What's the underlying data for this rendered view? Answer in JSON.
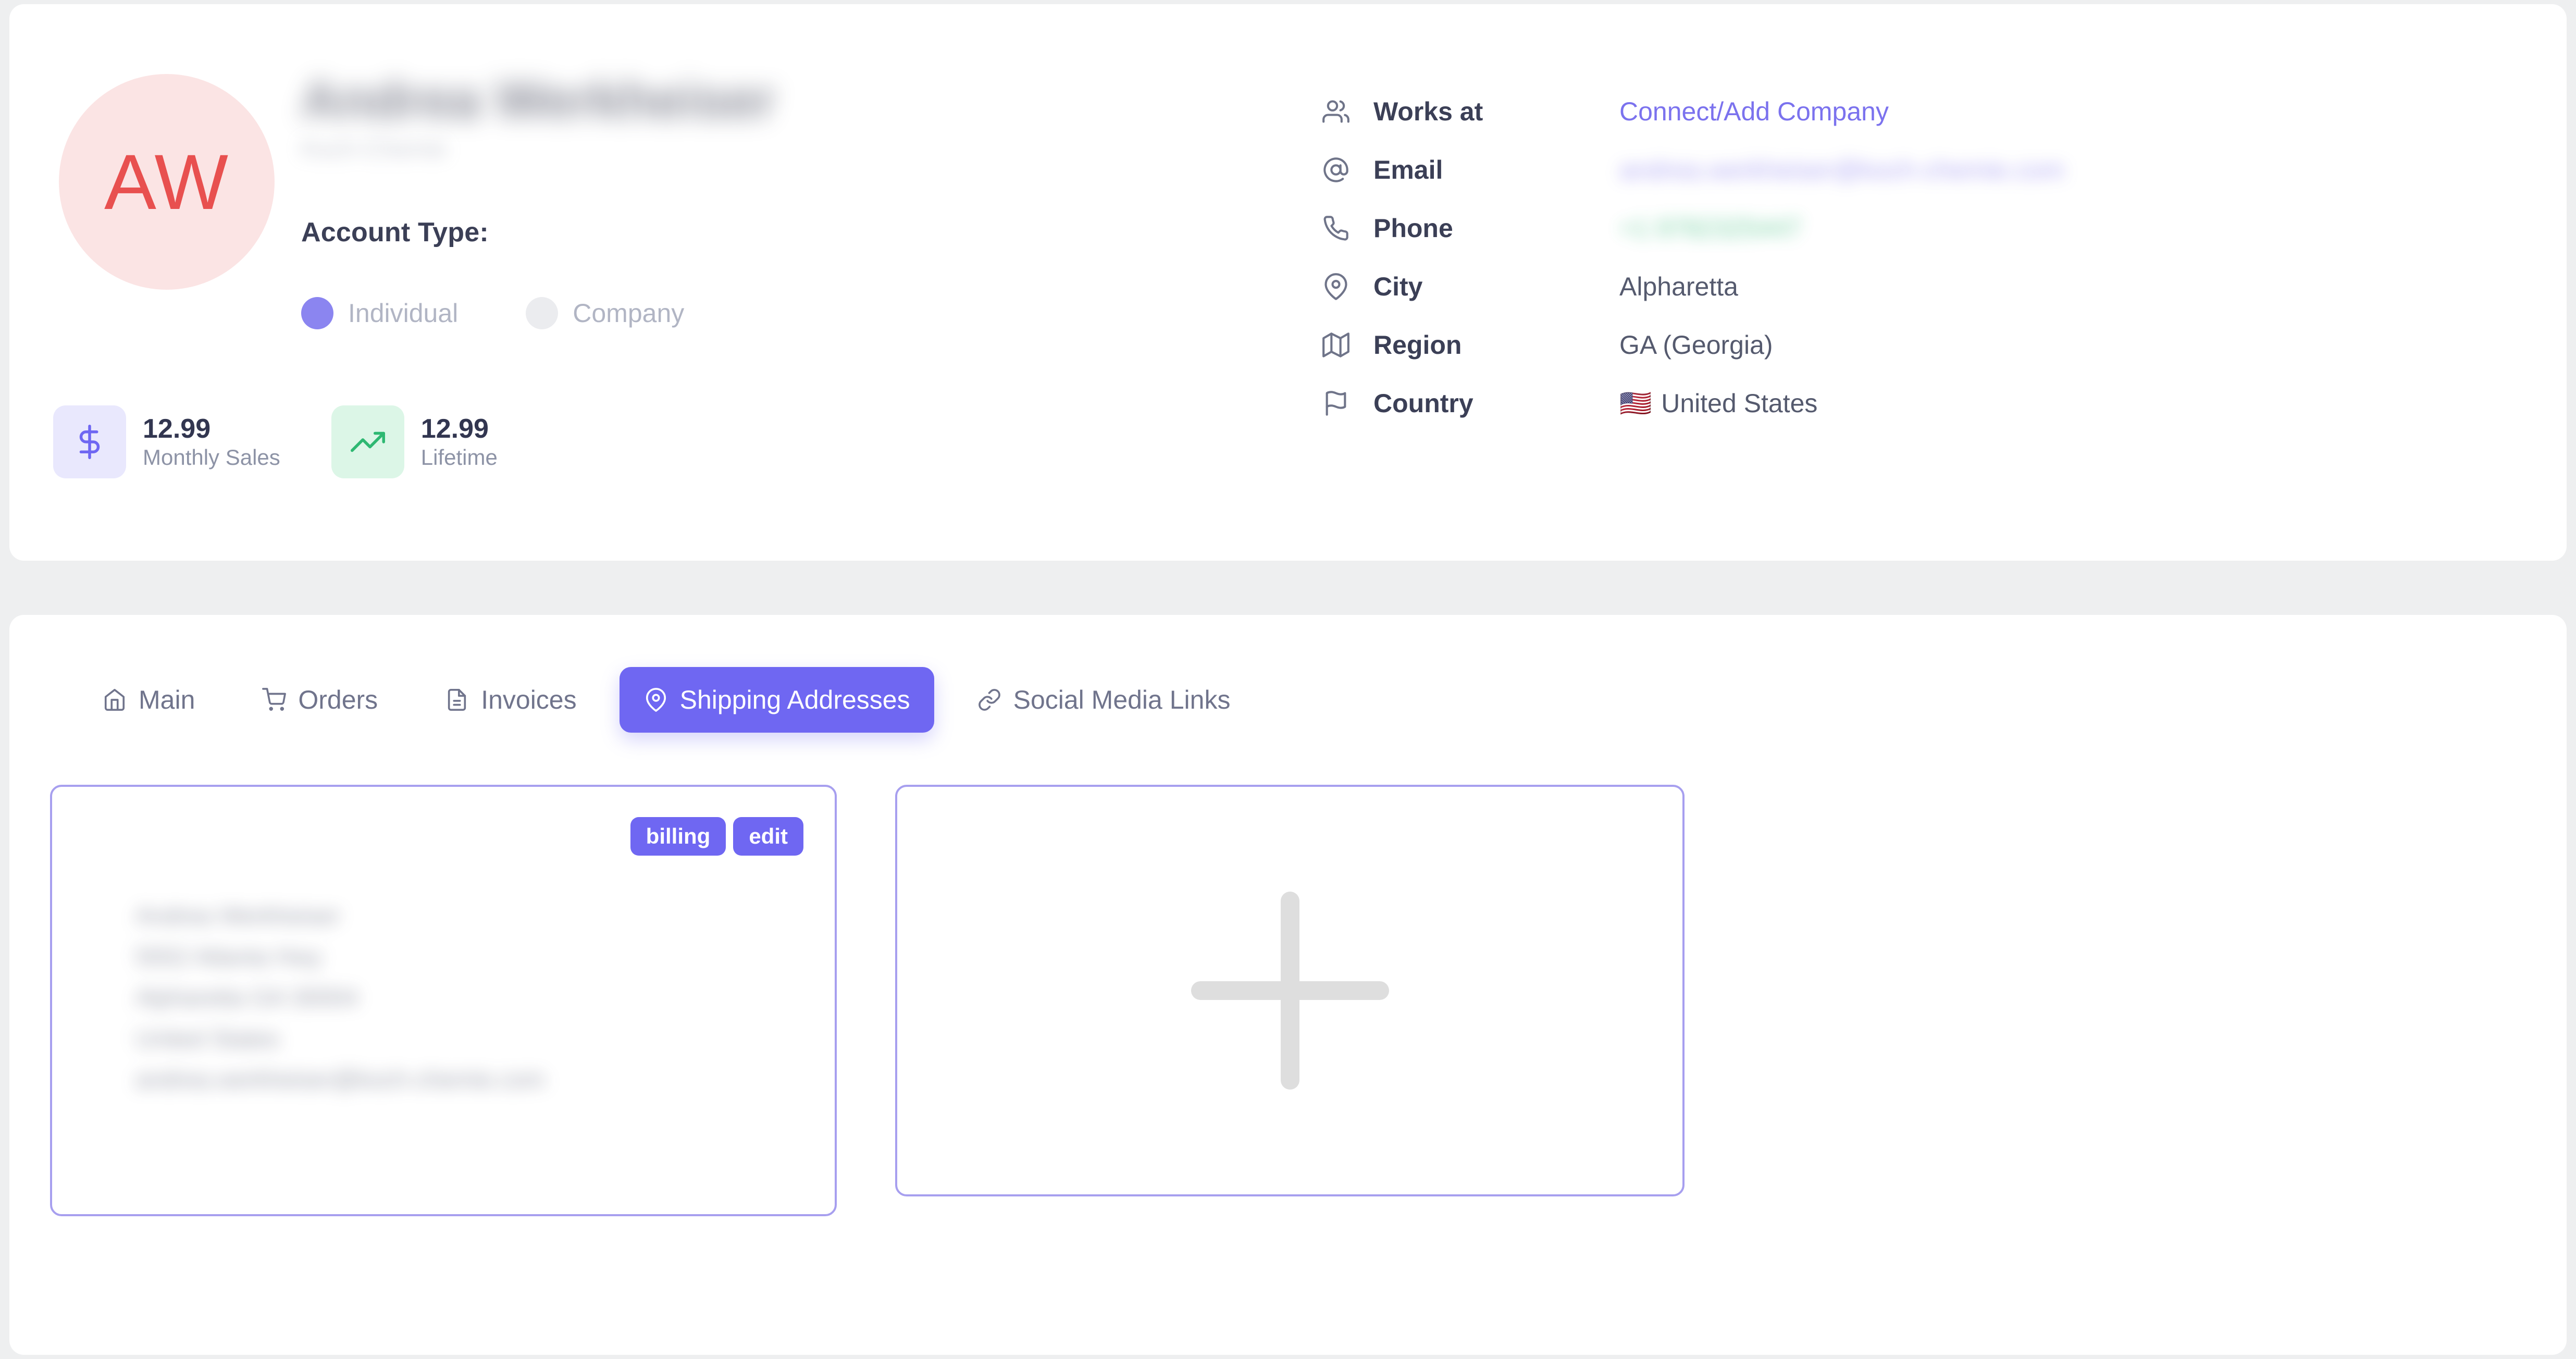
{
  "profile": {
    "avatar_initials": "AW",
    "avatar_bg": "#fbe4e4",
    "avatar_fg": "#e8504f",
    "name": "Andrea Werkheiser",
    "subtitle": "Koch-Chemie",
    "account_type_label": "Account Type:",
    "account_types": [
      {
        "label": "Individual",
        "selected": true
      },
      {
        "label": "Company",
        "selected": false
      }
    ],
    "stats": [
      {
        "icon": "dollar-icon",
        "value": "12.99",
        "label": "Monthly Sales",
        "tone": "indigo"
      },
      {
        "icon": "trending-up-icon",
        "value": "12.99",
        "label": "Lifetime",
        "tone": "green"
      }
    ]
  },
  "info": {
    "rows": [
      {
        "icon": "users-icon",
        "label": "Works at",
        "value": "Connect/Add Company",
        "style": "link"
      },
      {
        "icon": "at-sign-icon",
        "label": "Email",
        "value": "andrea.werkheiser@koch-chemie.com",
        "style": "blur-purple"
      },
      {
        "icon": "phone-icon",
        "label": "Phone",
        "value": "+1 9782325447",
        "style": "blur-green"
      },
      {
        "icon": "map-pin-icon",
        "label": "City",
        "value": "Alpharetta",
        "style": "plain"
      },
      {
        "icon": "map-icon",
        "label": "Region",
        "value": "GA (Georgia)",
        "style": "plain"
      },
      {
        "icon": "flag-icon",
        "label": "Country",
        "value": "United States",
        "style": "plain",
        "flag": "🇺🇸"
      }
    ]
  },
  "tabs": [
    {
      "icon": "home-icon",
      "label": "Main",
      "active": false
    },
    {
      "icon": "shopping-cart-icon",
      "label": "Orders",
      "active": false
    },
    {
      "icon": "file-text-icon",
      "label": "Invoices",
      "active": false
    },
    {
      "icon": "map-pin-icon",
      "label": "Shipping Addresses",
      "active": true
    },
    {
      "icon": "link-icon",
      "label": "Social Media Links",
      "active": false
    }
  ],
  "addresses": {
    "card": {
      "badges": [
        {
          "label": "billing"
        },
        {
          "label": "edit"
        }
      ],
      "lines": [
        "Andrea Werkheiser",
        "5552 Atlanta Hwy",
        "Alpharetta GA 30004",
        "United States",
        "andrea.werkheiser@koch-chemie.com"
      ]
    },
    "add_card": {
      "icon": "plus-icon"
    }
  },
  "colors": {
    "accent": "#6f67f2",
    "accent_light": "#a79fef",
    "link": "#7b72ee",
    "green": "#3fbf7f",
    "avatar_red": "#e8504f",
    "page_bg": "#eeeff0"
  }
}
